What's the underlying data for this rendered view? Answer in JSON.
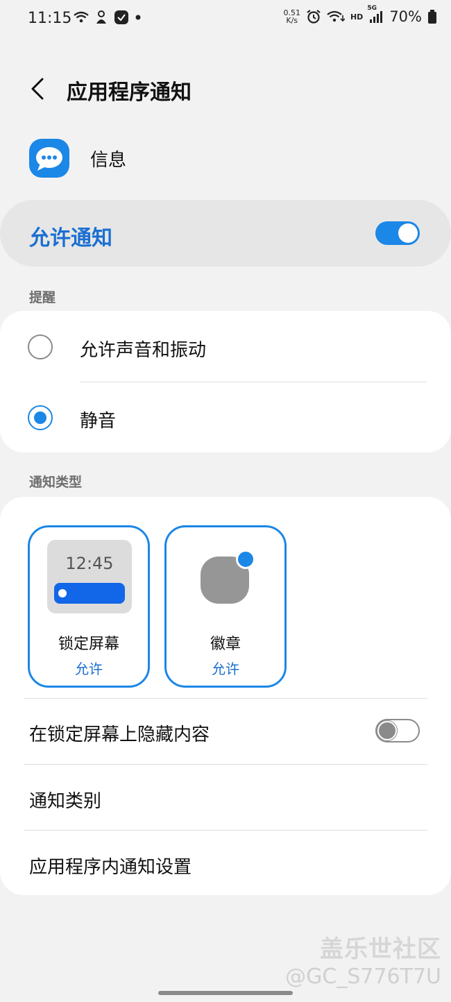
{
  "status_bar": {
    "time": "11:15",
    "speed_value": "0.51",
    "speed_unit": "K/s",
    "hd_label": "HD",
    "network_label": "5G",
    "battery": "70%"
  },
  "header": {
    "title": "应用程序通知"
  },
  "app": {
    "name": "信息"
  },
  "allow_notifications": {
    "label": "允许通知",
    "enabled": true
  },
  "alerts": {
    "section_label": "提醒",
    "options": [
      {
        "label": "允许声音和振动",
        "selected": false
      },
      {
        "label": "静音",
        "selected": true
      }
    ]
  },
  "notification_types": {
    "section_label": "通知类型",
    "tiles": [
      {
        "label": "锁定屏幕",
        "status": "允许",
        "preview_time": "12:45"
      },
      {
        "label": "徽章",
        "status": "允许"
      }
    ]
  },
  "settings": {
    "hide_content_label": "在锁定屏幕上隐藏内容",
    "hide_content_enabled": false,
    "categories_label": "通知类别",
    "in_app_label": "应用程序内通知设置"
  },
  "watermark": {
    "line1": "盖乐世社区",
    "line2": "@GC_S776T7U"
  },
  "colors": {
    "accent": "#1b87e6",
    "accent_text": "#1a6fd1",
    "background": "#f2f2f2"
  }
}
